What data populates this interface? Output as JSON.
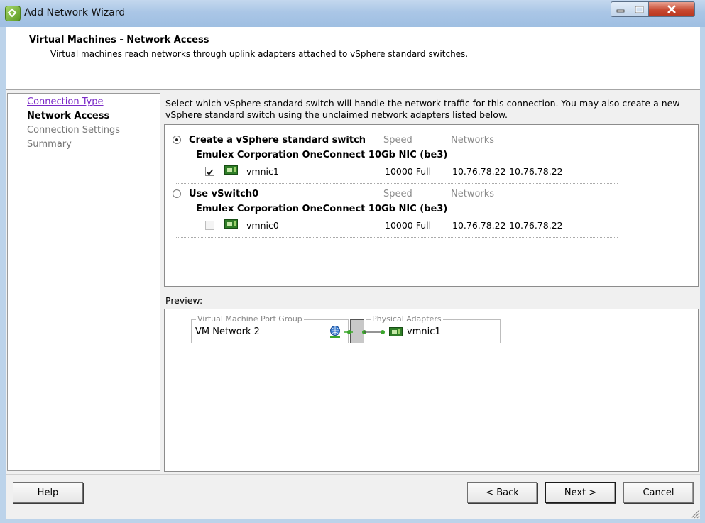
{
  "window": {
    "title": "Add Network Wizard",
    "icon": "wizard-app-icon",
    "controls": [
      "minimize-icon",
      "maximize-icon",
      "close-icon"
    ]
  },
  "header": {
    "title": "Virtual Machines - Network Access",
    "subtitle": "Virtual machines reach networks through uplink adapters attached to vSphere standard switches."
  },
  "steps": [
    {
      "label": "Connection Type",
      "state": "visited-link"
    },
    {
      "label": "Network Access",
      "state": "current"
    },
    {
      "label": "Connection Settings",
      "state": "pending"
    },
    {
      "label": "Summary",
      "state": "pending"
    }
  ],
  "instructions": "Select which vSphere standard switch will handle the network traffic for this connection. You may also create a new vSphere standard switch using the unclaimed network adapters listed below.",
  "columns": {
    "speed": "Speed",
    "networks": "Networks"
  },
  "options": [
    {
      "label": "Create a vSphere standard switch",
      "selected": true,
      "nic_title": "Emulex Corporation OneConnect 10Gb NIC (be3)",
      "adapter": {
        "name": "vmnic1",
        "checked": true,
        "speed": "10000 Full",
        "networks": "10.76.78.22-10.76.78.22"
      }
    },
    {
      "label": "Use vSwitch0",
      "selected": false,
      "nic_title": "Emulex Corporation OneConnect 10Gb NIC (be3)",
      "adapter": {
        "name": "vmnic0",
        "checked": false,
        "speed": "10000 Full",
        "networks": "10.76.78.22-10.76.78.22"
      }
    }
  ],
  "preview": {
    "label": "Preview:",
    "port_group_title": "Virtual Machine Port Group",
    "port_group_name": "VM Network 2",
    "adapters_title": "Physical Adapters",
    "adapter_name": "vmnic1"
  },
  "buttons": {
    "help": "Help",
    "back": "< Back",
    "next": "Next >",
    "cancel": "Cancel"
  },
  "colors": {
    "visited_link": "#7b2bc7",
    "nic_green": "#2f7d27",
    "link_green": "#3aa52b",
    "title_bar": "#aac6e6"
  }
}
